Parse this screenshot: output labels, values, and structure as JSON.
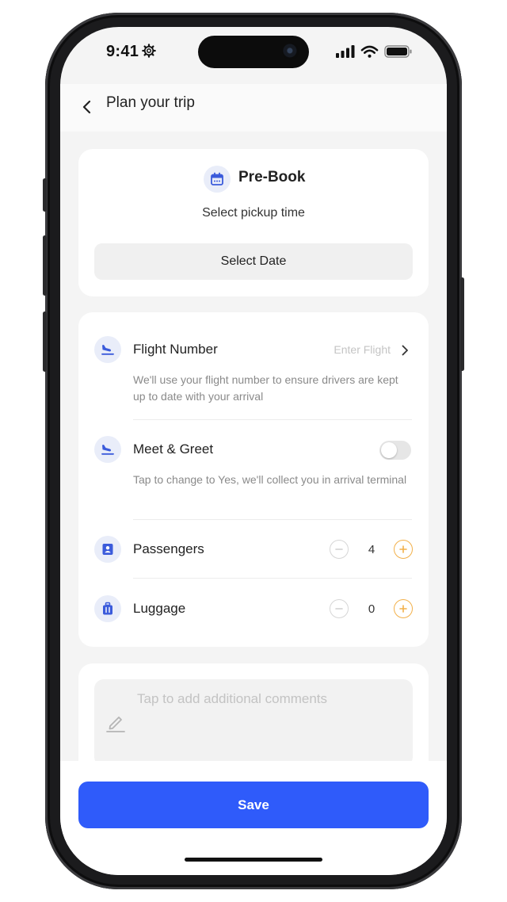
{
  "status_bar": {
    "time": "9:41"
  },
  "header": {
    "title": "Plan your trip"
  },
  "prebook": {
    "title": "Pre-Book",
    "subtitle": "Select pickup time",
    "select_date_label": "Select Date"
  },
  "flight": {
    "label": "Flight Number",
    "placeholder": "Enter Flight",
    "description": "We'll use your flight number to ensure drivers are kept up to date with your arrival"
  },
  "meet_greet": {
    "label": "Meet & Greet",
    "description": "Tap to change to Yes, we'll collect you in arrival terminal",
    "enabled": false
  },
  "passengers": {
    "label": "Passengers",
    "count": "4"
  },
  "luggage": {
    "label": "Luggage",
    "count": "0"
  },
  "comments": {
    "placeholder": "Tap to add additional comments"
  },
  "footer": {
    "save_label": "Save"
  },
  "colors": {
    "primary": "#2f5bfa",
    "accent_orange": "#f2b04a",
    "icon_bg": "#e9edf9",
    "icon_blue": "#3b5bdb"
  }
}
